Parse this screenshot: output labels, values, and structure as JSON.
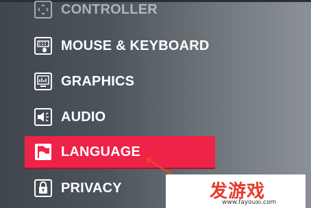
{
  "menu": {
    "items": [
      {
        "label": "CONTROLLER",
        "icon": "controller-icon",
        "selected": false
      },
      {
        "label": "MOUSE & KEYBOARD",
        "icon": "keyboard-icon",
        "selected": false
      },
      {
        "label": "GRAPHICS",
        "icon": "monitor-icon",
        "selected": false
      },
      {
        "label": "AUDIO",
        "icon": "speaker-icon",
        "selected": false
      },
      {
        "label": "LANGUAGE",
        "icon": "flag-icon",
        "selected": true
      },
      {
        "label": "PRIVACY",
        "icon": "lock-icon",
        "selected": false
      }
    ]
  },
  "colors": {
    "selected_background": "#ef2247",
    "text": "#ffffff",
    "annotation_arrow": "#e8462a",
    "watermark_logo": "#e83a2d"
  },
  "watermark": {
    "logo_text": "发游戏",
    "url": "www.fayouxi.com"
  }
}
